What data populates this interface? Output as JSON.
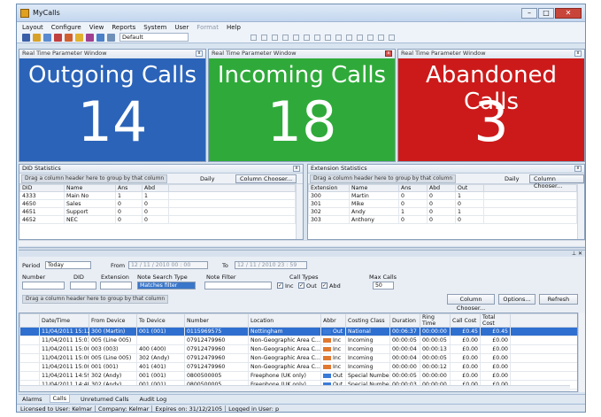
{
  "window": {
    "title": "MyCalls"
  },
  "menu": [
    "Layout",
    "Configure",
    "View",
    "Reports",
    "System",
    "User",
    "Format",
    "Help"
  ],
  "toolbar": {
    "layout_select": "Default"
  },
  "rtp_panels": [
    {
      "header": "Real Time Parameter Window",
      "label": "Outgoing Calls",
      "value": "14",
      "color": "#2b63b8"
    },
    {
      "header": "Real Time Parameter Window",
      "label": "Incoming Calls",
      "value": "18",
      "color": "#2faa3a"
    },
    {
      "header": "Real Time Parameter Window",
      "label": "Abandoned Calls",
      "value": "3",
      "color": "#cc1a1a"
    }
  ],
  "did_stats": {
    "header": "DID Statistics",
    "group_hint": "Drag a column header here to group by that column",
    "period": "Daily",
    "chooser": "Column Chooser...",
    "columns": [
      "DID",
      "Name",
      "Ans",
      "Abd"
    ],
    "rows": [
      [
        "4333",
        "Main No",
        "1",
        "1"
      ],
      [
        "4650",
        "Sales",
        "0",
        "0"
      ],
      [
        "4651",
        "Support",
        "0",
        "0"
      ],
      [
        "4652",
        "NEC",
        "0",
        "0"
      ]
    ]
  },
  "ext_stats": {
    "header": "Extension Statistics",
    "group_hint": "Drag a column header here to group by that column",
    "period": "Daily",
    "chooser": "Column Chooser...",
    "columns": [
      "Extension",
      "Name",
      "Ans",
      "Abd",
      "Out"
    ],
    "rows": [
      [
        "300",
        "Martin",
        "0",
        "0",
        "1"
      ],
      [
        "301",
        "Mike",
        "0",
        "0",
        "0"
      ],
      [
        "302",
        "Andy",
        "1",
        "0",
        "1"
      ],
      [
        "303",
        "Anthony",
        "0",
        "0",
        "0"
      ]
    ]
  },
  "filters": {
    "period_label": "Period",
    "period_value": "Today",
    "from_label": "From",
    "from_value": "12 / 11 / 2010  00 : 00",
    "to_label": "To",
    "to_value": "12 / 11 / 2010  23 : 59",
    "number_label": "Number",
    "did_label": "DID",
    "extension_label": "Extension",
    "note_search_label": "Note Search Type",
    "note_search_value": "Matches filter",
    "note_filter_label": "Note Filter",
    "call_types_label": "Call Types",
    "type_inc": "Inc",
    "type_out": "Out",
    "type_abd": "Abd",
    "max_calls_label": "Max Calls",
    "max_calls_value": "50",
    "group_hint": "Drag a column header here to group by that column",
    "chooser": "Column Chooser...",
    "options": "Options...",
    "refresh": "Refresh"
  },
  "calls": {
    "columns": [
      "Date/Time",
      "From Device",
      "To Device",
      "Number",
      "Location",
      "Abbr",
      "Costing Class",
      "Duration",
      "Ring Time",
      "Call Cost",
      "Total Cost"
    ],
    "rows": [
      [
        "11/04/2011 15:12",
        "300 (Martin)",
        "001 (001)",
        "0115969575",
        "Nottingham",
        "Out",
        "National",
        "00:06:37",
        "00:00:00",
        "£0.45",
        "£0.45"
      ],
      [
        "11/04/2011 15:01",
        "005 (Line 005)",
        "",
        "07912479960",
        "Non-Geographic Area C...",
        "Inc",
        "Incoming",
        "00:00:05",
        "00:00:05",
        "£0.00",
        "£0.00"
      ],
      [
        "11/04/2011 15:00",
        "003 (003)",
        "400 (400)",
        "07912479960",
        "Non-Geographic Area C...",
        "Inc",
        "Incoming",
        "00:00:04",
        "00:00:13",
        "£0.00",
        "£0.00"
      ],
      [
        "11/04/2011 15:00",
        "005 (Line 005)",
        "302 (Andy)",
        "07912479960",
        "Non-Geographic Area C...",
        "Inc",
        "Incoming",
        "00:00:04",
        "00:00:05",
        "£0.00",
        "£0.00"
      ],
      [
        "11/04/2011 15:00",
        "001 (001)",
        "401 (401)",
        "07912479960",
        "Non-Geographic Area C...",
        "Inc",
        "Incoming",
        "00:00:00",
        "00:00:12",
        "£0.00",
        "£0.00"
      ],
      [
        "11/04/2011 14:59",
        "302 (Andy)",
        "001 (001)",
        "0800500005",
        "Freephone (UK only)",
        "Out",
        "Special Numbe...",
        "00:00:05",
        "00:00:00",
        "£0.00",
        "£0.00"
      ],
      [
        "11/04/2011 14:48",
        "302 (Andy)",
        "001 (001)",
        "0800500005",
        "Freephone (UK only)",
        "Out",
        "Special Numbe...",
        "00:00:03",
        "00:00:00",
        "£0.00",
        "£0.00"
      ]
    ]
  },
  "bottom_tabs": [
    "Alarms",
    "Calls",
    "Unreturned Calls",
    "Audit Log"
  ],
  "status": {
    "licensed": "Licensed to User: Kelmar",
    "company": "Company: Kelmar",
    "expires": "Expires on: 31/12/2105",
    "logged": "Logged in User: p"
  },
  "colors": {
    "outgoing": "#2b63b8",
    "incoming": "#2faa3a",
    "abandoned": "#cc1a1a",
    "selected_row": "#2f6fcf"
  }
}
